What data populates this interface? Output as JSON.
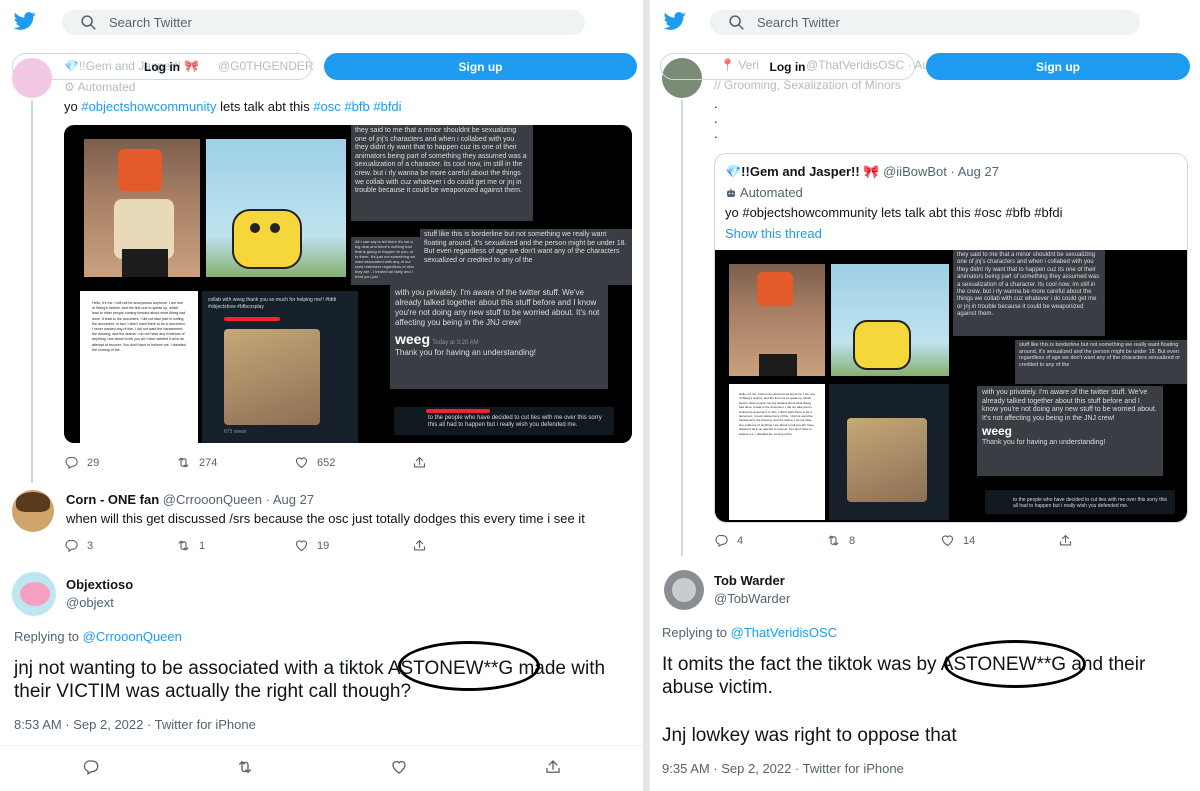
{
  "search_placeholder": "Search Twitter",
  "login_label": "Log in",
  "signup_label": "Sign up",
  "colors": {
    "accent": "#1d9bf0",
    "muted": "#536471",
    "text": "#0f1419"
  },
  "left": {
    "tweet": {
      "author_name": "💎!!Gem and Jasper!! 🎀",
      "author_handle": "@G0THGENDER",
      "automated": "Automated",
      "text_prefix": "yo ",
      "tags": [
        "#objectshowcommunity",
        "lets talk abt this",
        "#osc",
        "#bfb",
        "#bfdi"
      ],
      "media": {
        "chat_top": "they said to me that a minor shouldnt be sexualizing one of jnj's characters and when i collabed with you they didnt rly want that to happen cuz its one of their animators being part of something they assumed was a sexualization of a character. its cool now, im still in the crew. but i rly wanna be more careful about the things we collab with cuz whatever i do could get me or jnj in trouble because it could be weaponized against them.",
        "chat_mid": "stuff like this is borderline but not something we really want floating around, it's sexualized and the person might be under 18. But even regardless of age we don't want any of the characters sexualized or credited to any of the",
        "chat_small": "All I can say is tell them it's not a big deal and there's nothing bad that is going to happen to you, or to them. It's just not something we want associated with any of our crew members regardless of who they are - I treated an fairly and I treat you just",
        "chat_big": "with you privately. I'm aware of the twitter stuff. We've already talked together about this stuff before and I know you're not doing any new stuff to be worried about. It's not affecting you being in the JNJ crew!",
        "weeg_name": "weeg",
        "weeg_time": "Today at 3:20 AM",
        "weeg_msg": "Thank you for having an understanding!",
        "dm_text": "to the people who have decided to cut ties with me over this sorry this all had to happen but i really wish you defended me.",
        "doc_text": "Hello, it's me. I will not be anonymous anymore. I am one of Weeg's victims, and the first one to speak up, which lead to other people coming forward about what Weeg had done. It lead to the document. I did not take part in writing the document. In fact, I didn't want there to be a document. I never wanted any of this. I did not want the harassment, the doxxing, and the drama. I do not have any evidence of anything I am about to tell you all I have deleted it all in an attempt to recover. You don't have to believe me. I dreaded the coming of the",
        "collab_text": "collab with weeg thank you so much for helping me!! #bfdi #objectshow #bfbcosplay",
        "views": "673 views"
      },
      "replies": "29",
      "retweets": "274",
      "likes": "652"
    },
    "reply1": {
      "name": "Corn - ONE fan",
      "handle": "@CrrooonQueen",
      "date": "Aug 27",
      "text": "when will this get discussed /srs because the osc just totally dodges  this every time i see it",
      "replies": "3",
      "retweets": "1",
      "likes": "19"
    },
    "main": {
      "name": "Objextioso",
      "handle": "@objext",
      "replying_label": "Replying to",
      "replying_handle": "@CrrooonQueen",
      "line1": "jnj not wanting to be associated with a tiktok ASTONEW**G made with",
      "line2": "their VICTIM was actually the right call though?",
      "meta": "8:53 AM · Sep 2, 2022 · Twitter for iPhone"
    }
  },
  "right": {
    "top_tweet": {
      "name": "Veri",
      "handle": "@ThatVeridisOSC · Aug 27",
      "bio": "// Grooming, Sexalization of Minors",
      "dots": "."
    },
    "quoted": {
      "name": "💎!!Gem and Jasper!! 🎀",
      "handle": "@iiBowBot",
      "date": "Aug 27",
      "automated": "Automated",
      "text": "yo #objectshowcommunity lets talk abt this #osc #bfb #bfdi",
      "show_thread": "Show this thread"
    },
    "stats": {
      "replies": "4",
      "retweets": "8",
      "likes": "14"
    },
    "main": {
      "name": "Tob Warder",
      "handle": "@TobWarder",
      "replying_label": "Replying to",
      "replying_handle": "@ThatVeridisOSC",
      "line1": "It omits the fact the tiktok was by ASTONEW**G and their",
      "line2": "abuse victim.",
      "line3": "Jnj lowkey was right to oppose that",
      "meta": "9:35 AM · Sep 2, 2022 · Twitter for iPhone"
    }
  }
}
